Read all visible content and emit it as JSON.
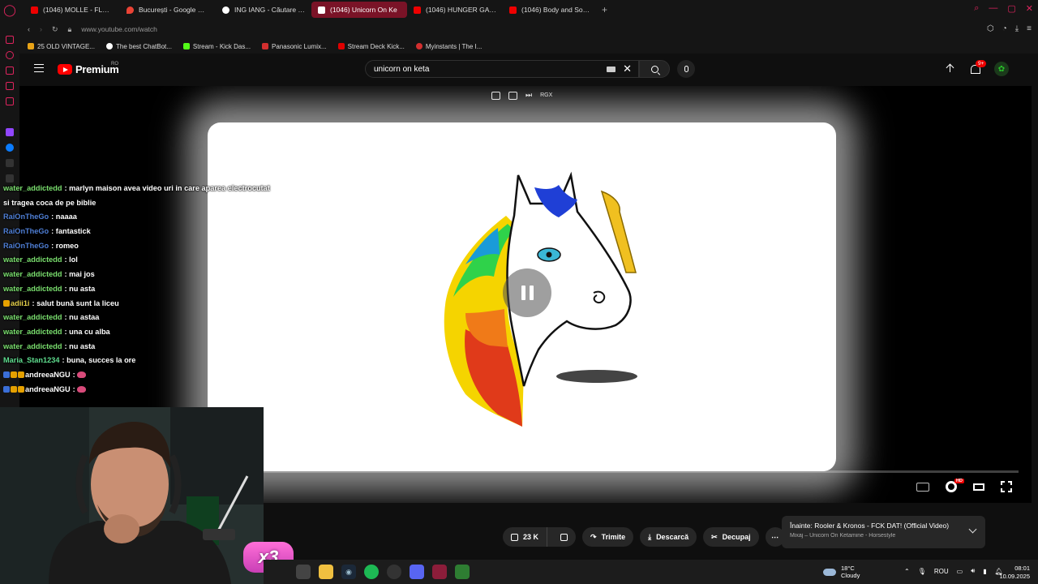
{
  "browser": {
    "tabs": [
      {
        "label": "(1046) MOLLE - FLEX/BLA",
        "icon": "youtube-icon",
        "active": false
      },
      {
        "label": "București - Google Maps",
        "icon": "maps-icon",
        "active": false
      },
      {
        "label": "ING IANG - Căutare Goog",
        "icon": "google-icon",
        "active": false
      },
      {
        "label": "(1046) Unicorn On Ke",
        "icon": "youtube-icon",
        "active": true
      },
      {
        "label": "(1046) HUNGER GAMES 2",
        "icon": "youtube-icon",
        "active": false
      },
      {
        "label": "(1046) Body and Soul (fe",
        "icon": "youtube-icon",
        "active": false
      }
    ],
    "url": "www.youtube.com/watch",
    "bookmarks": [
      {
        "label": "25 OLD VINTAGE...",
        "color": "#e8a317"
      },
      {
        "label": "The best ChatBot...",
        "color": "#ffffff"
      },
      {
        "label": "Stream - Kick Das...",
        "color": "#53fc18"
      },
      {
        "label": "Panasonic Lumix...",
        "color": "#d32f2f"
      },
      {
        "label": "Stream Deck Kick...",
        "color": "#e00000"
      },
      {
        "label": "Myinstants | The I...",
        "color": "#d32f2f"
      }
    ]
  },
  "youtube": {
    "logo_text": "Premium",
    "country": "RO",
    "search_value": "unicorn on keta",
    "notifications": "9+",
    "mini_toolbar_label": "RGX"
  },
  "player": {
    "progress_fraction": 0.0
  },
  "chat": [
    {
      "user": "water_addictedd",
      "msg": "marlyn maison avea video uri in care aparea electrocutat",
      "color": "u-green"
    },
    {
      "user": "",
      "msg": "si tragea coca de pe biblie",
      "color": ""
    },
    {
      "user": "RaiOnTheGo",
      "msg": "naaaa",
      "color": "u-blue"
    },
    {
      "user": "RaiOnTheGo",
      "msg": "fantastick",
      "color": "u-blue"
    },
    {
      "user": "RaiOnTheGo",
      "msg": "romeo",
      "color": "u-blue"
    },
    {
      "user": "water_addictedd",
      "msg": "lol",
      "color": "u-green"
    },
    {
      "user": "water_addictedd",
      "msg": "mai jos",
      "color": "u-green"
    },
    {
      "user": "water_addictedd",
      "msg": "nu asta",
      "color": "u-green"
    },
    {
      "user": "adii1i",
      "msg": "salut bună sunt la liceu",
      "color": "u-yellow"
    },
    {
      "user": "water_addictedd",
      "msg": "nu astaa",
      "color": "u-green"
    },
    {
      "user": "water_addictedd",
      "msg": "una cu alba",
      "color": "u-green"
    },
    {
      "user": "water_addictedd",
      "msg": "nu asta",
      "color": "u-green"
    },
    {
      "user": "Maria_Stan1234",
      "msg": "buna, succes la ore",
      "color": "u-lime"
    },
    {
      "user": "andreeaNGU",
      "msg": "",
      "color": "u-white"
    },
    {
      "user": "andreeaNGU",
      "msg": "",
      "color": "u-white"
    }
  ],
  "actions": {
    "likes": "23 K",
    "share": "Trimite",
    "download": "Descarcă",
    "clip": "Decupaj"
  },
  "up_next": {
    "title": "Înainte: Rooler & Kronos - FCK DAT! (Official Video)",
    "subtitle": "Mixaj – Unicorn On Ketamine - Horsestyle"
  },
  "overlay_badge": "x3",
  "taskbar": {
    "temperature": "18°C",
    "weather": "Cloudy",
    "language": "ROU",
    "time": "08:01",
    "date": "10.09.2025"
  }
}
